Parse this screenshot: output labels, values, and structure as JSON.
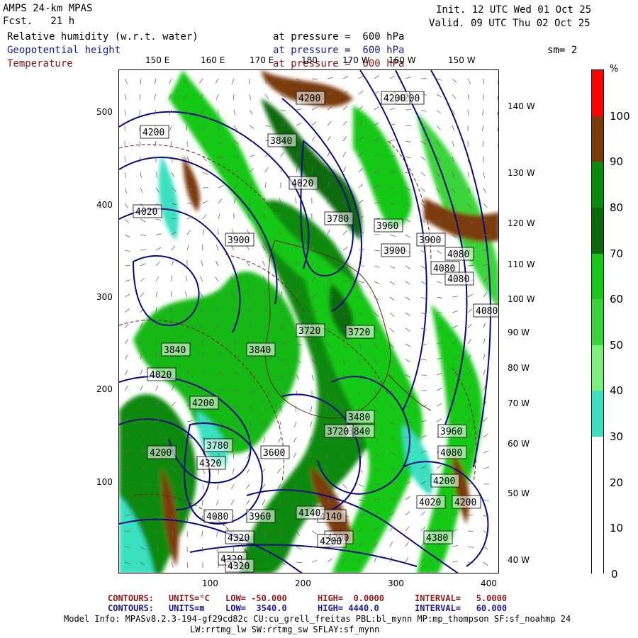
{
  "header": {
    "model": "AMPS 24-km MPAS",
    "fcst": "Fcst.   21 h",
    "init": "Init. 12 UTC Wed 01 Oct 25",
    "valid": "Valid. 09 UTC Thu 02 Oct 25",
    "field1": "Relative humidity (w.r.t. water)",
    "field1_level": "at pressure =  600 hPa",
    "field2": "Geopotential height",
    "field2_level": "at pressure =  600 hPa",
    "field3": "Temperature",
    "field3_level": "at pressure =  600 hPa",
    "smoothing": "sm= 2"
  },
  "axes": {
    "x_ticks": [
      "100",
      "200",
      "300",
      "400"
    ],
    "y_ticks": [
      "500",
      "400",
      "300",
      "200",
      "100"
    ],
    "lon_top": [
      "150 E",
      "160 E",
      "170 E",
      "180",
      "170 W",
      "160 W",
      "150 W"
    ],
    "lon_right": [
      "140 W",
      "130 W",
      "120 W",
      "110 W",
      "100 W",
      "90 W",
      "80 W",
      "70 W",
      "60 W",
      "50 W",
      "40 W"
    ]
  },
  "colorbar": {
    "unit": "%",
    "labels": [
      "100",
      "90",
      "80",
      "70",
      "60",
      "50",
      "40",
      "30",
      "20",
      "10",
      "0"
    ],
    "colors": [
      "#ff0000",
      "#7a3a0a",
      "#0a8a0a",
      "#0a6a0a",
      "#18c818",
      "#3ad43a",
      "#7af07a",
      "#3ae0c0",
      "#ffffff",
      "#ffffff",
      "#ffffff"
    ]
  },
  "height_labels": [
    "4200",
    "4320",
    "4200",
    "4200",
    "4080",
    "4200",
    "4020",
    "4140",
    "4020",
    "3900",
    "4080",
    "4200",
    "3780",
    "3960",
    "3900",
    "4080",
    "3900",
    "4020",
    "3840",
    "3840",
    "3720",
    "3840",
    "4020",
    "3960",
    "3720",
    "3720",
    "3780",
    "4080",
    "4200",
    "3600",
    "3480",
    "3840",
    "4200",
    "3960",
    "4080",
    "4140",
    "4080",
    "4200",
    "4200",
    "4320",
    "4200",
    "4320",
    "4320",
    "4380"
  ],
  "footer": {
    "line1_label": "CONTOURS:",
    "line1_units": "UNITS=°C",
    "line1_low": "LOW= -50.000",
    "line1_high": "HIGH=  0.0000",
    "line1_interval": "INTERVAL=   5.0000",
    "line2_label": "CONTOURS:",
    "line2_units": "UNITS=m",
    "line2_low": "LOW=  3540.0",
    "line2_high": "HIGH= 4440.0",
    "line2_interval": "INTERVAL=   60.000",
    "model_info_1": "Model Info: MPASv8.2.3-194-gf29cd82c CU:cu_grell_freitas PBL:bl_mynn MP:mp_thompson SF:sf_noahmp 24",
    "model_info_2": "LW:rrtmg_lw SW:rrtmg_sw SFLAY:sf_mynn"
  }
}
